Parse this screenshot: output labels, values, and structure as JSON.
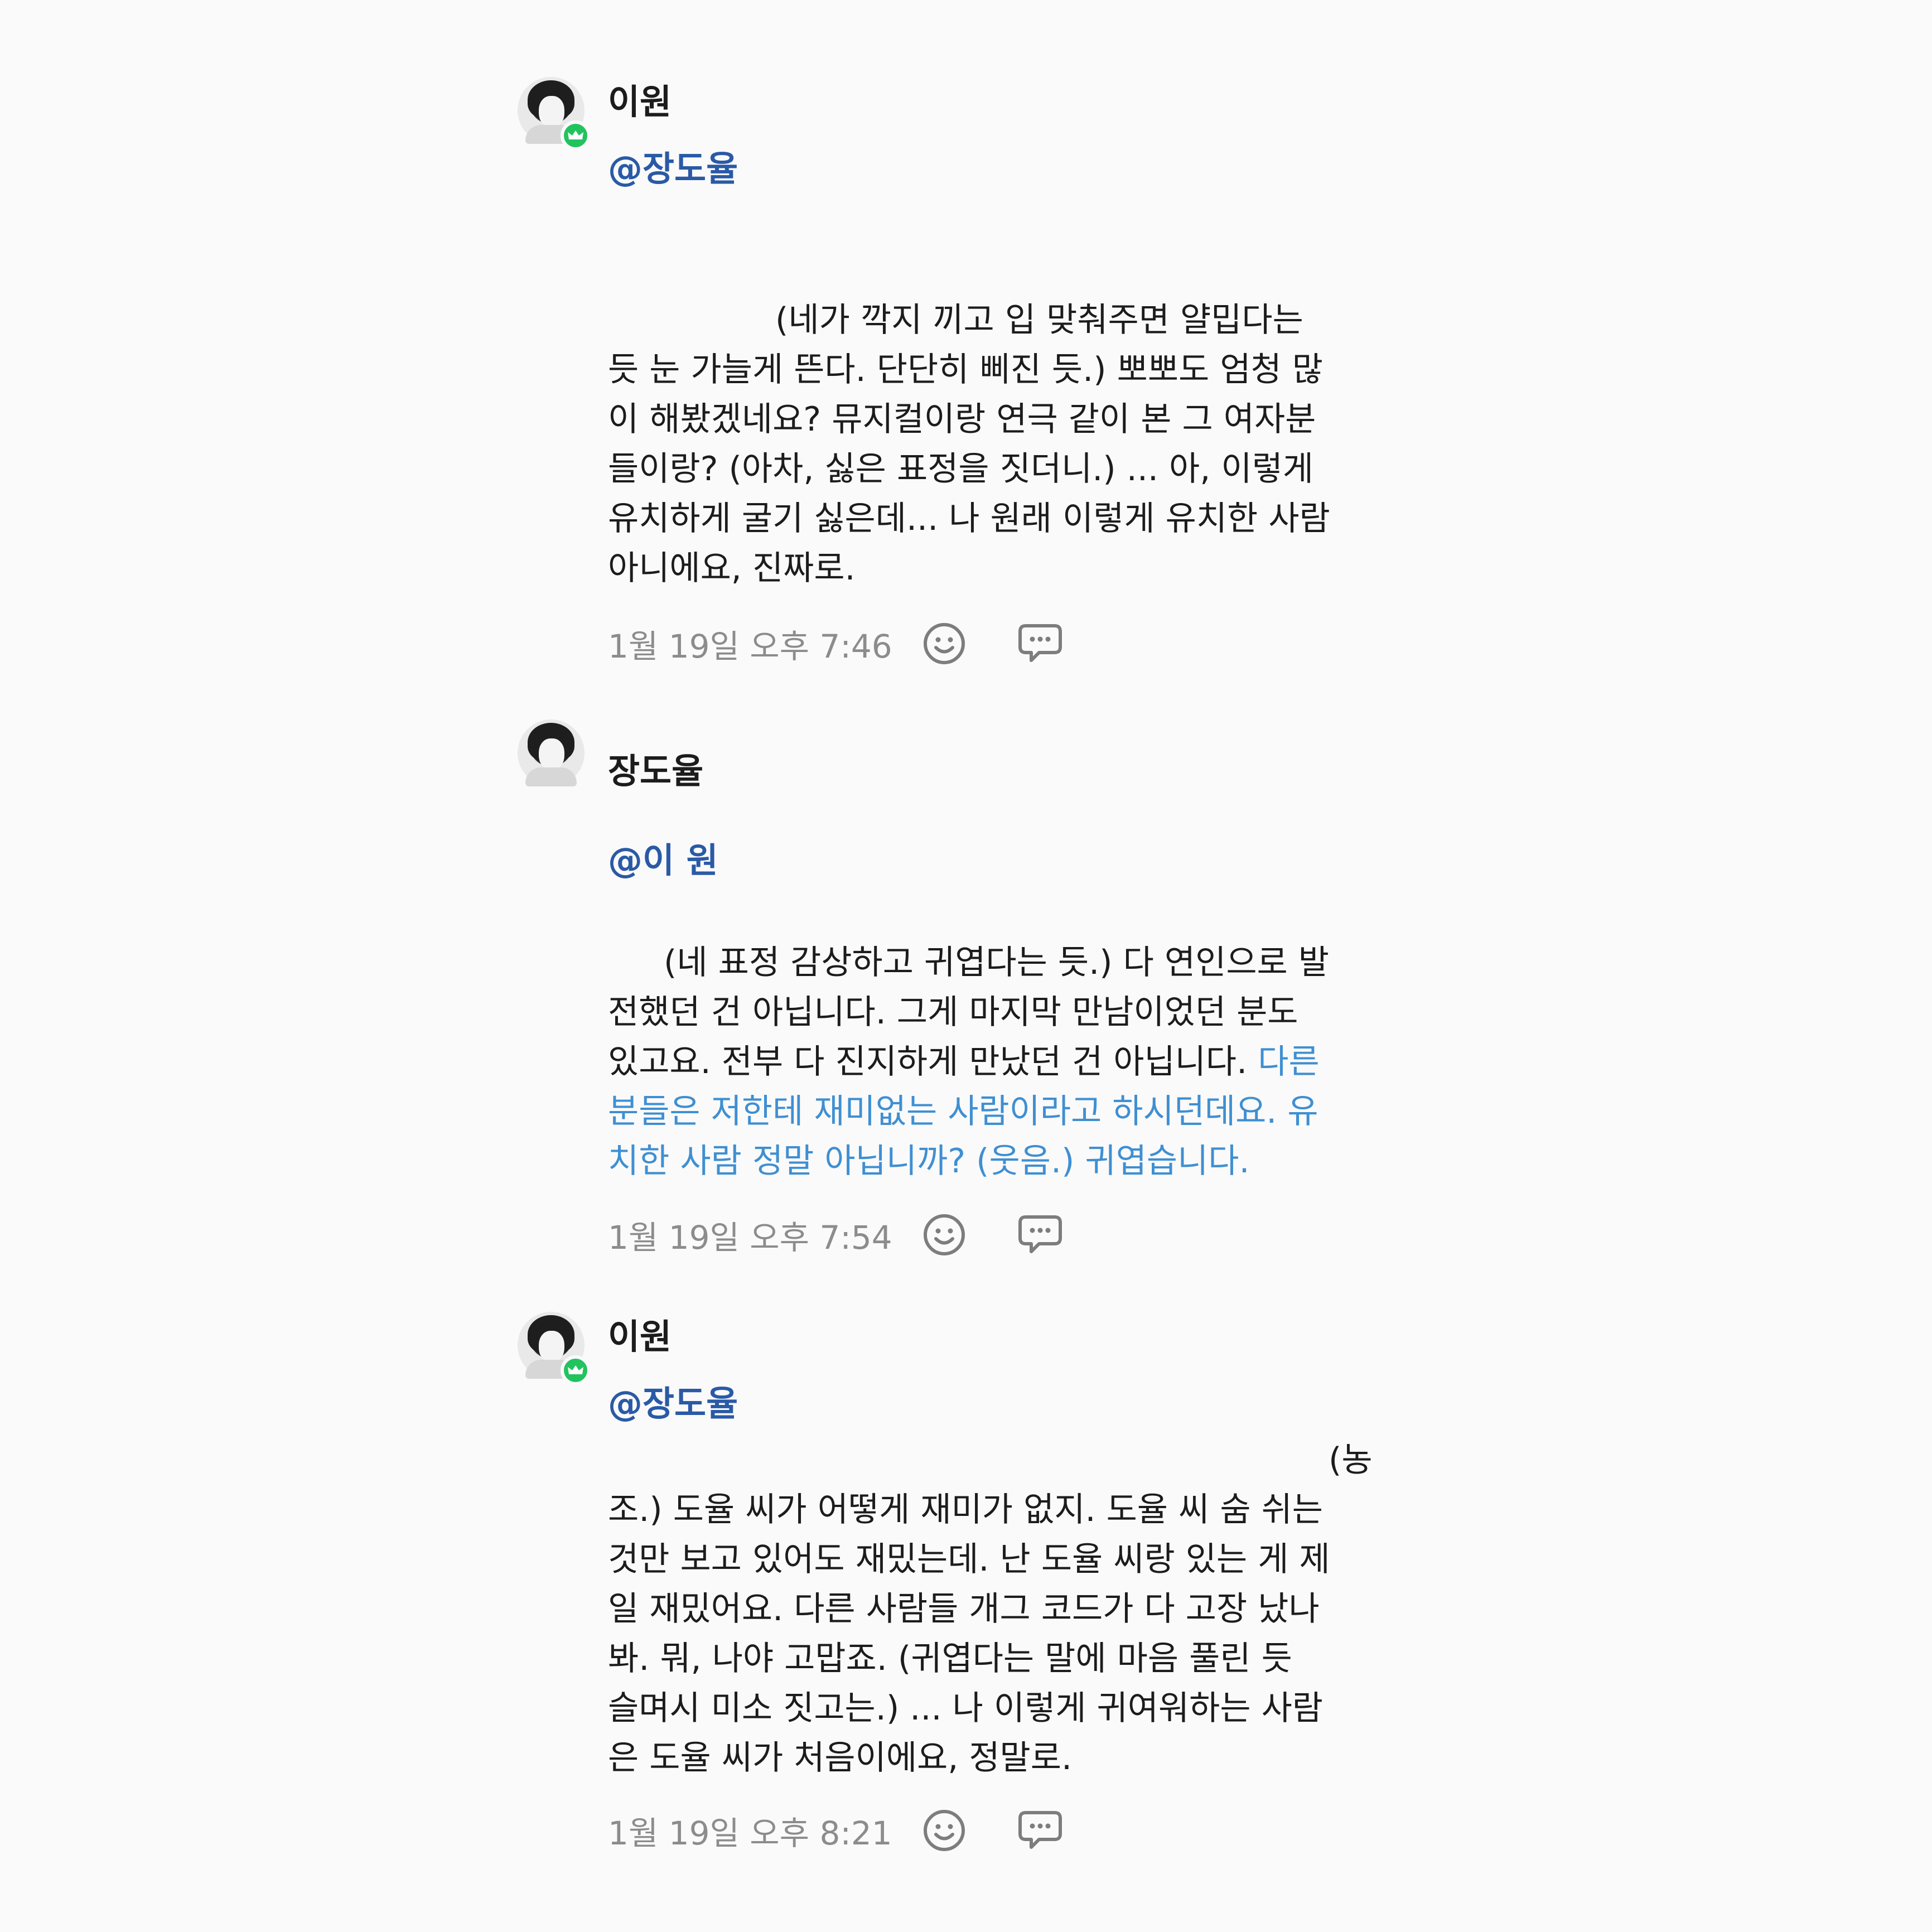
{
  "posts": [
    {
      "author": "이원",
      "mention": "@장도율",
      "verified": true,
      "body": "(네가 깍지 끼고 입 맞춰주면 얄밉다는\n듯 눈 가늘게 뜬다. 단단히 삐진 듯.) 뽀뽀도 엄청 많\n이 해봤겠네요? 뮤지컬이랑 연극 같이 본 그 여자분\n들이랑? (아차, 싫은 표정을 짓더니.) ... 아, 이렇게\n유치하게 굴기 싫은데... 나 원래 이렇게 유치한 사람\n아니에요, 진짜로.",
      "time": "1월 19일 오후 7:46"
    },
    {
      "author": "장도율",
      "mention": "@이 원",
      "verified": false,
      "body": "(네 표정 감상하고 귀엽다는 듯.) 다 연인으로 발\n전했던 건 아닙니다. 그게 마지막 만남이었던 분도\n있고요. 전부 다 진지하게 만났던 건 아닙니다. ",
      "body_highlight": "다른\n분들은 저한테 재미없는 사람이라고 하시던데요. 유\n치한 사람 정말 아닙니까? (웃음.) 귀엽습니다.",
      "time": "1월 19일 오후 7:54"
    },
    {
      "author": "이원",
      "mention": "@장도율",
      "verified": true,
      "body": "(농\n조.) 도율 씨가 어떻게 재미가 없지. 도율 씨 숨 쉬는\n것만 보고 있어도 재밌는데. 난 도율 씨랑 있는 게 제\n일 재밌어요. 다른 사람들 개그 코드가 다 고장 났나\n봐. 뭐, 나야 고맙죠. (귀엽다는 말에 마음 풀린 듯\n슬며시 미소 짓고는.) ... 나 이렇게 귀여워하는 사람\n은 도율 씨가 처음이에요, 정말로.",
      "time": "1월 19일 오후 8:21"
    }
  ],
  "icons": {
    "react": "smile-icon",
    "reply": "comment-icon",
    "badge": "crown-icon"
  },
  "colors": {
    "mention": "#2a5aa6",
    "highlight": "#3f8fd2",
    "badge": "#22c35e",
    "timestamp": "#8c8c8c"
  }
}
